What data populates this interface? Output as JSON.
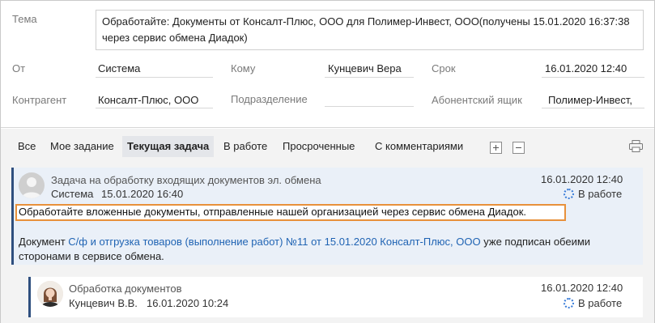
{
  "form": {
    "subject_label": "Тема",
    "subject_value": "Обработайте: Документы от Консалт-Плюс, ООО для Полимер-Инвест, ООО(получены 15.01.2020 16:37:38 через сервис обмена Диадок)",
    "from_label": "От",
    "from_value": "Система",
    "to_label": "Кому",
    "to_value": "Кунцевич Вера",
    "deadline_label": "Срок",
    "deadline_value": "16.01.2020 12:40",
    "counterparty_label": "Контрагент",
    "counterparty_value": "Консалт-Плюс, ООО",
    "department_label": "Подразделение",
    "department_value": "",
    "mailbox_label": "Абонентский ящик",
    "mailbox_value": "Полимер-Инвест, "
  },
  "tabs": {
    "items": [
      {
        "label": "Все"
      },
      {
        "label": "Мое задание"
      },
      {
        "label": "Текущая задача"
      },
      {
        "label": "В работе"
      },
      {
        "label": "Просроченные"
      },
      {
        "label": "С комментариями"
      }
    ]
  },
  "feed": {
    "card1": {
      "title": "Задача на обработку входящих документов эл. обмена",
      "author": "Система",
      "datetime": "15.01.2020 16:40",
      "deadline": "16.01.2020 12:40",
      "status": "В работе",
      "message": "Обработайте вложенные документы, отправленные нашей организацией через сервис обмена Диадок.",
      "doc_prefix": "Документ ",
      "doc_link": "С/ф и отгрузка товаров (выполнение работ) №11 от 15.01.2020 Консалт-Плюс, ООО",
      "doc_suffix": " уже подписан обеими сторонами в сервисе обмена."
    },
    "card2": {
      "title": "Обработка документов",
      "author": "Кунцевич В.В.",
      "datetime": "16.01.2020 10:24",
      "deadline": "16.01.2020 12:40",
      "status": "В работе"
    }
  },
  "colors": {
    "accent": "#2f4f7f",
    "link": "#1f63b3",
    "highlight": "#e8913b",
    "card_bg": "#eaf0f8"
  }
}
